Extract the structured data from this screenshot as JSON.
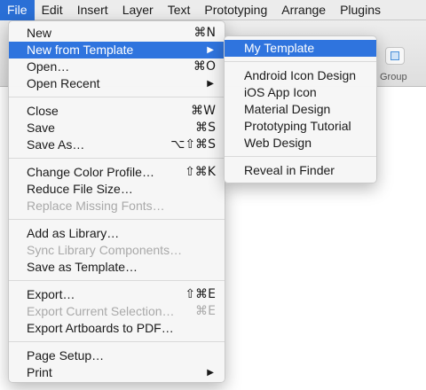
{
  "menubar": {
    "items": [
      "File",
      "Edit",
      "Insert",
      "Layer",
      "Text",
      "Prototyping",
      "Arrange",
      "Plugins"
    ]
  },
  "toolbar": {
    "group_label": "Group"
  },
  "file_menu": {
    "new": {
      "label": "New",
      "shortcut": "⌘N"
    },
    "new_from_template": {
      "label": "New from Template"
    },
    "open": {
      "label": "Open…",
      "shortcut": "⌘O"
    },
    "open_recent": {
      "label": "Open Recent"
    },
    "close": {
      "label": "Close",
      "shortcut": "⌘W"
    },
    "save": {
      "label": "Save",
      "shortcut": "⌘S"
    },
    "save_as": {
      "label": "Save As…",
      "shortcut": "⌥⇧⌘S"
    },
    "change_color_profile": {
      "label": "Change Color Profile…",
      "shortcut": "⇧⌘K"
    },
    "reduce_file_size": {
      "label": "Reduce File Size…"
    },
    "replace_missing_fonts": {
      "label": "Replace Missing Fonts…"
    },
    "add_as_library": {
      "label": "Add as Library…"
    },
    "sync_library_components": {
      "label": "Sync Library Components…"
    },
    "save_as_template": {
      "label": "Save as Template…"
    },
    "export": {
      "label": "Export…",
      "shortcut": "⇧⌘E"
    },
    "export_current_selection": {
      "label": "Export Current Selection…",
      "shortcut": "⌘E"
    },
    "export_artboards_pdf": {
      "label": "Export Artboards to PDF…"
    },
    "page_setup": {
      "label": "Page Setup…"
    },
    "print": {
      "label": "Print"
    }
  },
  "template_submenu": {
    "my_template": "My Template",
    "templates": [
      "Android Icon Design",
      "iOS App Icon",
      "Material Design",
      "Prototyping Tutorial",
      "Web Design"
    ],
    "reveal_in_finder": "Reveal in Finder"
  },
  "colors": {
    "accent": "#2f74de",
    "disabled": "#a9a9a9"
  }
}
